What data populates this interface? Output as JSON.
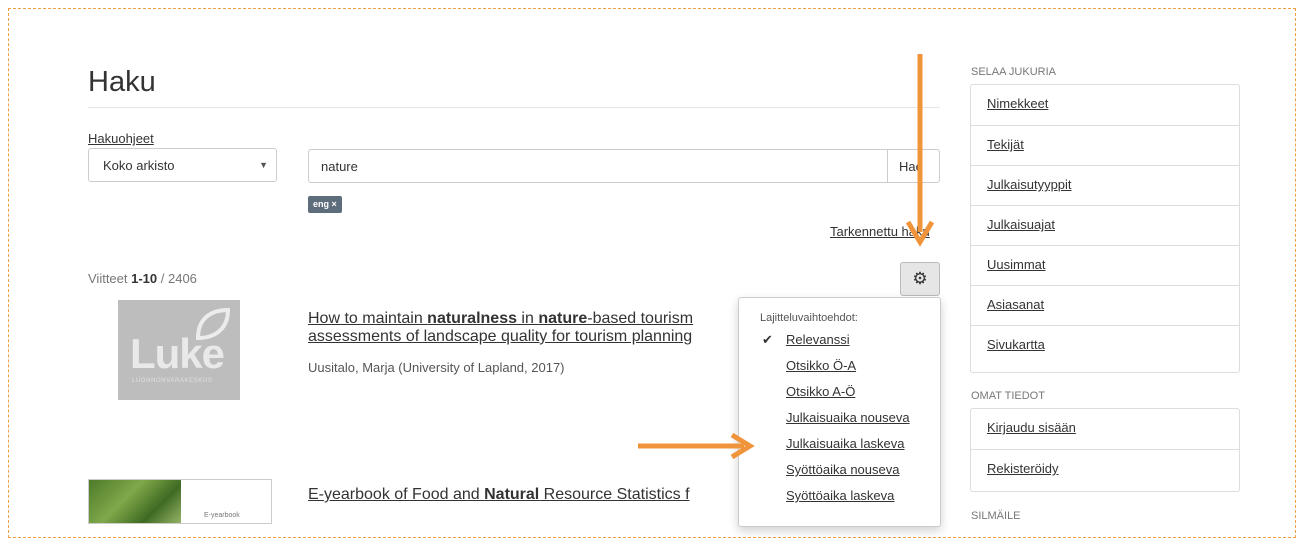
{
  "page": {
    "title": "Haku"
  },
  "search": {
    "help_link": "Hakuohjeet",
    "scope_value": "Koko arkisto",
    "query": "nature",
    "button_label": "Hae",
    "filter_tag": "eng ×",
    "advanced_link": "Tarkennettu haku"
  },
  "results": {
    "count_prefix": "Viitteet ",
    "count_range": "1-10",
    "count_total": " / 2406",
    "items": [
      {
        "title_parts": [
          "How to maintain ",
          "naturalness",
          " in ",
          "nature",
          "-based tourism"
        ],
        "title_line2": "assessments of landscape quality for tourism planning",
        "meta": "Uusitalo, Marja (University of Lapland, 2017)",
        "thumb_logo": "Luke",
        "thumb_sub": "LUONNONVARAKESKUS"
      },
      {
        "title_parts": [
          "E-yearbook of Food and ",
          "Natural",
          " Resource Statistics f"
        ],
        "thumb_text": "E-yearbook"
      }
    ]
  },
  "sort_menu": {
    "header": "Lajitteluvaihtoehdot:",
    "items": [
      "Relevanssi",
      "Otsikko Ö-A",
      "Otsikko A-Ö",
      "Julkaisuaika nouseva",
      "Julkaisuaika laskeva",
      "Syöttöaika nouseva",
      "Syöttöaika laskeva"
    ],
    "selected_index": 0
  },
  "sidebar": {
    "browse_heading": "SELAA JUKURIA",
    "browse_items": [
      "Nimekkeet",
      "Tekijät",
      "Julkaisutyyppit",
      "Julkaisuajat",
      "Uusimmat",
      "Asiasanat",
      "Sivukartta"
    ],
    "account_heading": "OMAT TIEDOT",
    "account_items": [
      "Kirjaudu sisään",
      "Rekisteröidy"
    ],
    "discover_heading": "SILMÄILE"
  },
  "colors": {
    "annotation_arrow": "#f0943c",
    "tag_bg": "#5e6d7c",
    "frame_dash": "#f0a040"
  },
  "icons": {
    "settings": "gear-icon",
    "dropdown": "caret-down-icon",
    "selected": "check-icon",
    "annotation": "arrow-icon"
  }
}
